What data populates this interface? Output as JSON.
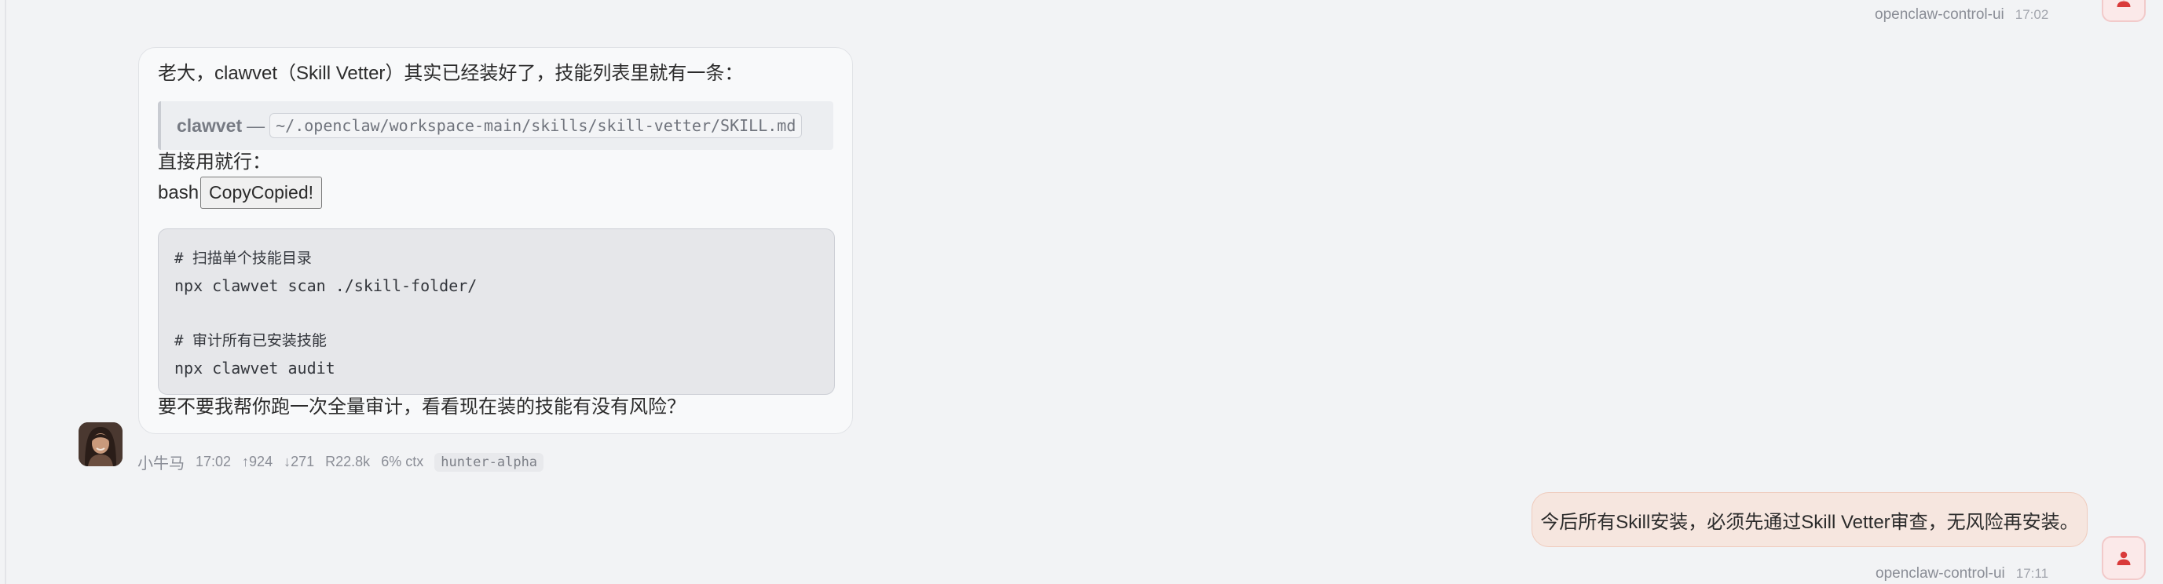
{
  "top_user_message": {
    "sender": "openclaw-control-ui",
    "time": "17:02"
  },
  "assistant_message": {
    "intro": "老大，clawvet（Skill Vetter）其实已经装好了，技能列表里就有一条：",
    "quote": {
      "name": "clawvet",
      "separator": "—",
      "path": "~/.openclaw/workspace-main/skills/skill-vetter/SKILL.md"
    },
    "direct_use": "直接用就行：",
    "code_lang": "bash",
    "copy_button_label": "CopyCopied!",
    "code_lines": [
      "# 扫描单个技能目录",
      "npx clawvet scan ./skill-folder/",
      "",
      "# 审计所有已安装技能",
      "npx clawvet audit"
    ],
    "question": "要不要我帮你跑一次全量审计，看看现在装的技能有没有风险？"
  },
  "assistant_meta": {
    "sender": "小牛马",
    "time": "17:02",
    "tokens_in": "↑924",
    "tokens_out": "↓271",
    "cache_read": "R22.8k",
    "context": "6% ctx",
    "model": "hunter-alpha"
  },
  "user_message": {
    "text": "今后所有Skill安装，必须先通过Skill Vetter审查，无风险再安装。",
    "sender": "openclaw-control-ui",
    "time": "17:11"
  },
  "colors": {
    "background": "#f2f3f5",
    "user_bubble": "#f6e6df",
    "user_avatar_icon": "#d93a3a",
    "assistant_bubble": "#f8f9fa"
  },
  "icons": {
    "user_avatar": "person-icon",
    "assistant_avatar": "assistant-photo"
  }
}
